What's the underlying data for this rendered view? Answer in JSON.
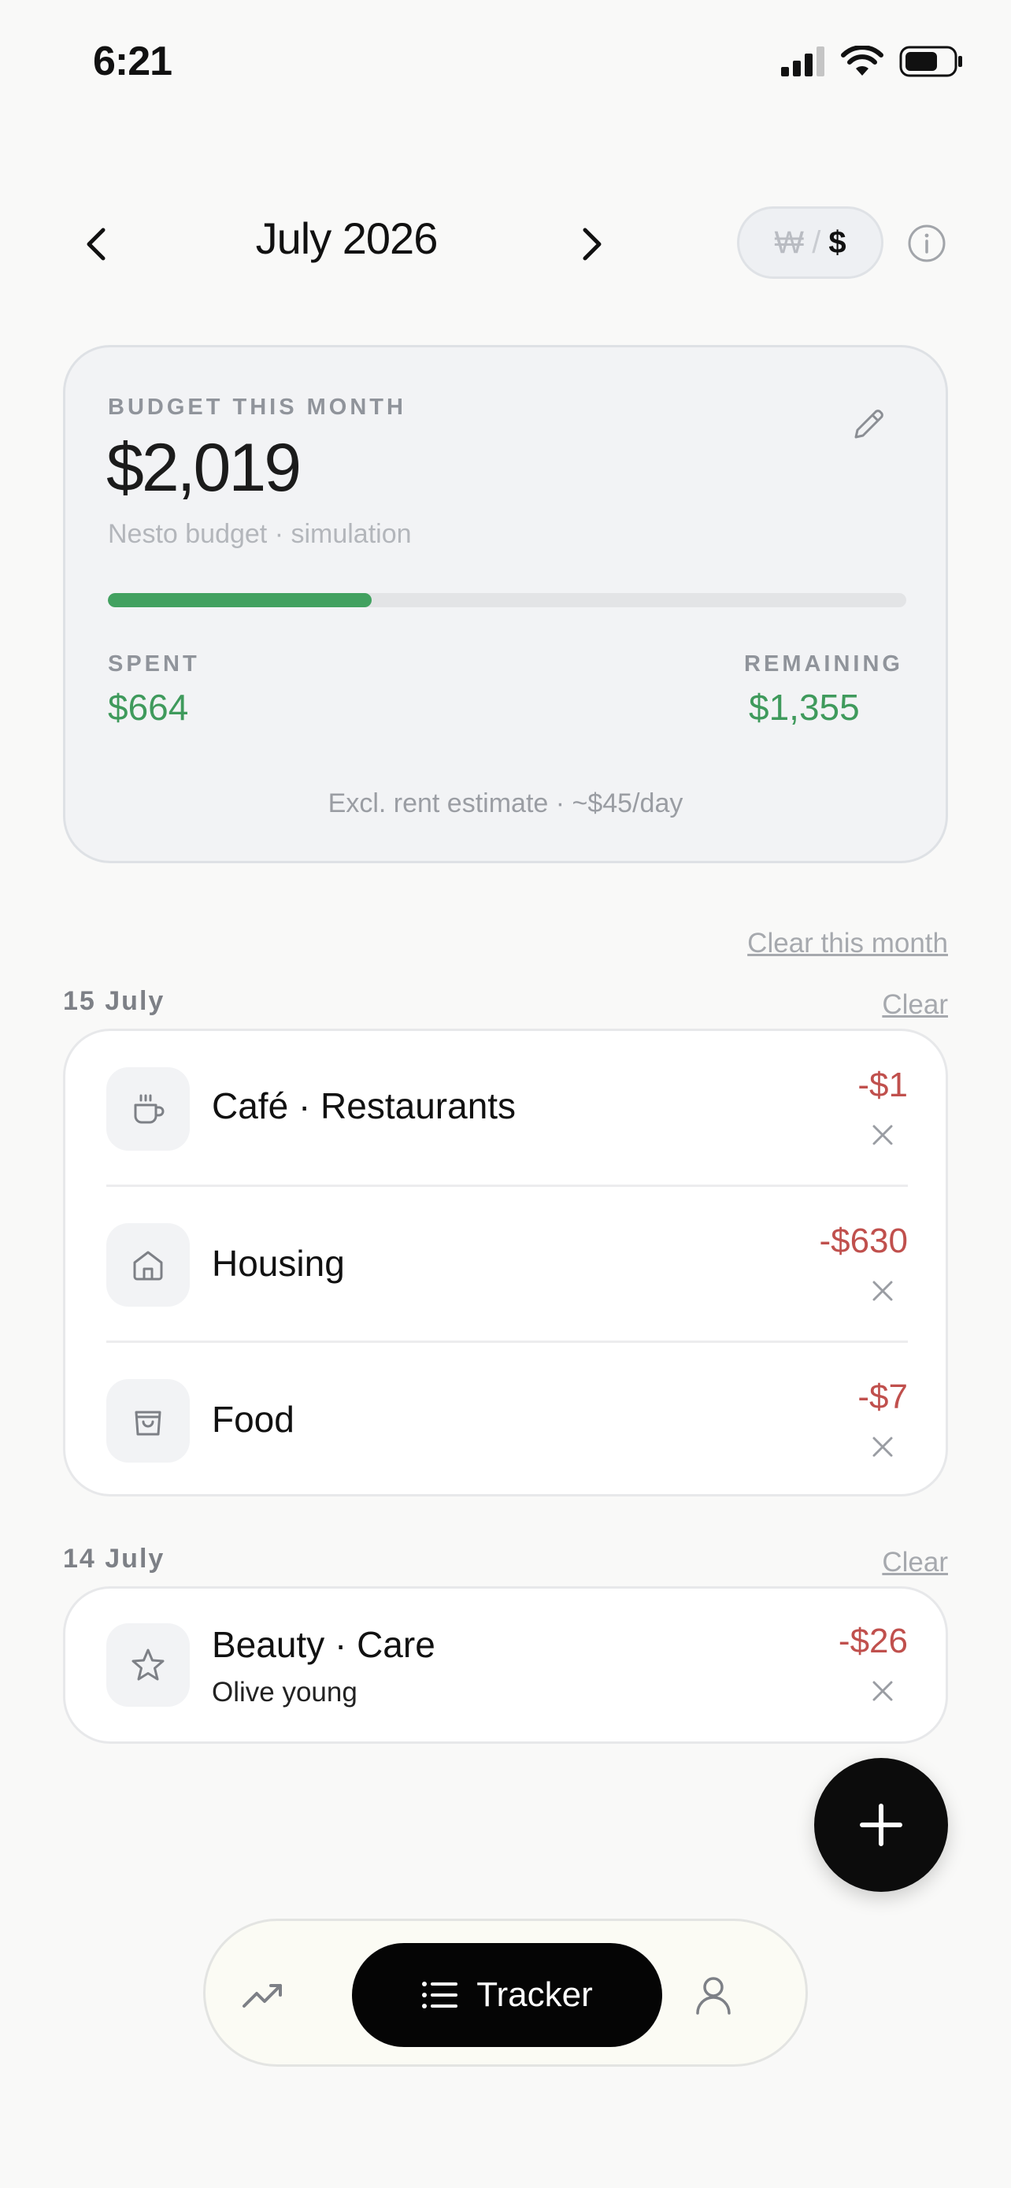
{
  "status_bar": {
    "time": "6:21"
  },
  "header": {
    "month": "July 2026",
    "currency": {
      "won": "₩",
      "separator": "/",
      "usd": "$"
    }
  },
  "budget": {
    "label": "BUDGET THIS MONTH",
    "amount": "$2,019",
    "subtitle": "Nesto budget · simulation",
    "progress_fraction": 0.33,
    "spent_label": "SPENT",
    "spent_value": "$664",
    "remaining_label": "REMAINING",
    "remaining_value": "$1,355",
    "footnote": "Excl. rent estimate · ~$45/day",
    "colors": {
      "progress": "#42a160",
      "positive": "#3f9a5c"
    }
  },
  "clear_month_label": "Clear this month",
  "days": [
    {
      "date": "15 July",
      "clear_label": "Clear",
      "transactions": [
        {
          "category": "Café · Restaurants",
          "amount": "-$1",
          "icon": "coffee-cup-icon"
        },
        {
          "category": "Housing",
          "amount": "-$630",
          "icon": "house-icon"
        },
        {
          "category": "Food",
          "amount": "-$7",
          "icon": "shopping-bag-icon"
        }
      ]
    },
    {
      "date": "14 July",
      "clear_label": "Clear",
      "transactions": [
        {
          "category": "Beauty · Care",
          "note": "Olive young",
          "amount": "-$26",
          "icon": "star-icon"
        }
      ]
    }
  ],
  "tabbar": {
    "active_label": "Tracker"
  },
  "colors": {
    "expense": "#c0504d",
    "fab": "#0c0c0c"
  }
}
